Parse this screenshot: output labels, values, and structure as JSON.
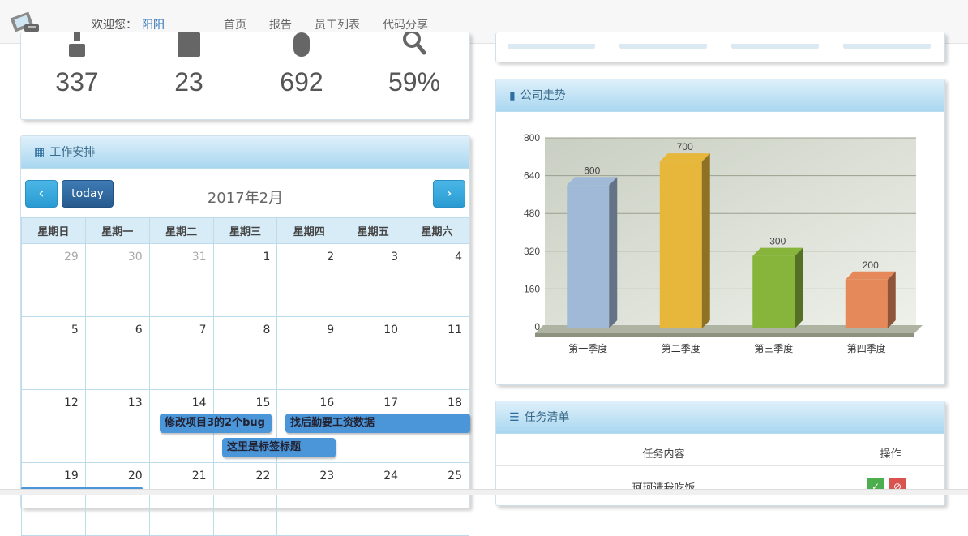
{
  "header": {
    "welcome_label": "欢迎您：",
    "user_name": "阳阳",
    "nav": [
      "首页",
      "报告",
      "员工列表",
      "代码分享"
    ]
  },
  "stats": [
    {
      "icon": "user-icon",
      "value": "337"
    },
    {
      "icon": "calendar-icon",
      "value": "23"
    },
    {
      "icon": "mouse-icon",
      "value": "692"
    },
    {
      "icon": "search-icon",
      "value": "59%"
    }
  ],
  "calendar": {
    "panel_title": "工作安排",
    "today_label": "today",
    "month_title": "2017年2月",
    "weekdays": [
      "星期日",
      "星期一",
      "星期二",
      "星期三",
      "星期四",
      "星期五",
      "星期六"
    ],
    "weeks": [
      [
        "29",
        "30",
        "31",
        "1",
        "2",
        "3",
        "4"
      ],
      [
        "5",
        "6",
        "7",
        "8",
        "9",
        "10",
        "11"
      ],
      [
        "12",
        "13",
        "14",
        "15",
        "16",
        "17",
        "18"
      ],
      [
        "19",
        "20",
        "21",
        "22",
        "23",
        "24",
        "25"
      ]
    ],
    "events": [
      "修改项目3的2个bug",
      "找后勤要工资数据",
      "这里是标签标题"
    ]
  },
  "chart_panel": {
    "title": "公司走势"
  },
  "chart_data": {
    "type": "bar",
    "categories": [
      "第一季度",
      "第二季度",
      "第三季度",
      "第四季度"
    ],
    "values": [
      600,
      700,
      300,
      200
    ],
    "ylim": [
      0,
      800
    ],
    "yticks": [
      "0",
      "160",
      "320",
      "480",
      "640",
      "800"
    ],
    "colors": [
      "#9fb9d6",
      "#e6b73a",
      "#87b43a",
      "#e6895a"
    ],
    "value_labels": [
      "600",
      "700",
      "300",
      "200"
    ],
    "grid": true
  },
  "tasks": {
    "title": "任务清单",
    "col_content": "任务内容",
    "col_op": "操作",
    "rows": [
      {
        "text": "珂珂请我吃饭"
      }
    ]
  }
}
